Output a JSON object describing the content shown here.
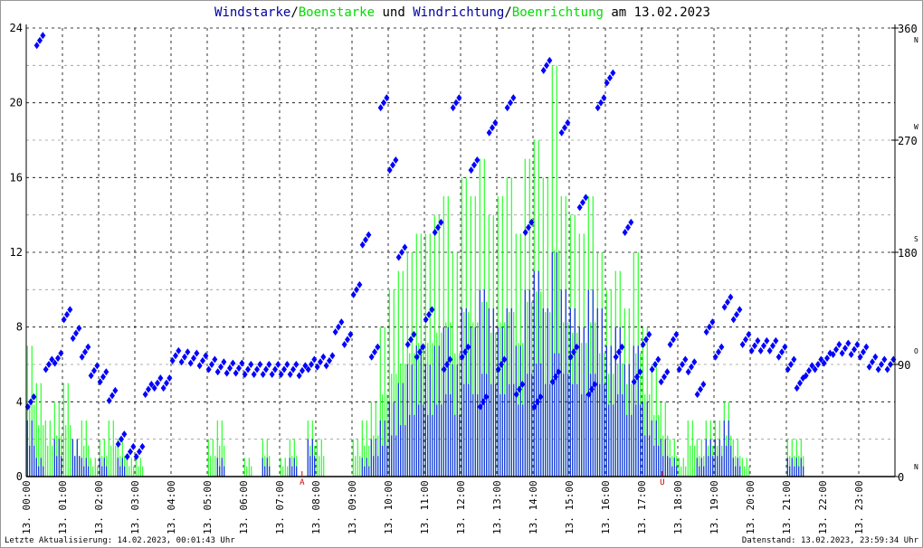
{
  "title": {
    "part1": "Windstarke",
    "sep1": "/",
    "part2": "Boenstarke",
    "mid": " und ",
    "part3": "Windrichtung",
    "sep2": "/",
    "part4": "Boenrichtung",
    "tail": " am 13.02.2023"
  },
  "footer": {
    "left": "Letzte Aktualisierung: 14.02.2023, 00:01:43 Uhr",
    "right": "Datenstand: 13.02.2023, 23:59:34 Uhr"
  },
  "colors": {
    "speed": "#0000ff",
    "gust": "#00ff00",
    "marker": "#cc0000",
    "title_speed": "#0000a0",
    "title_gust": "#00dd00"
  },
  "chart_data": {
    "type": "bar",
    "title": "Windstarke/Boenstarke und Windrichtung/Boenrichtung am 13.02.2023",
    "x_unit": "hour",
    "x_tick_labels": [
      "13. 00:00",
      "13. 01:00",
      "13. 02:00",
      "13. 03:00",
      "13. 04:00",
      "13. 05:00",
      "13. 06:00",
      "13. 07:00",
      "13. 08:00",
      "13. 09:00",
      "13. 10:00",
      "13. 11:00",
      "13. 12:00",
      "13. 13:00",
      "13. 14:00",
      "13. 15:00",
      "13. 16:00",
      "13. 17:00",
      "13. 18:00",
      "13. 19:00",
      "13. 20:00",
      "13. 21:00",
      "13. 22:00",
      "13. 23:00"
    ],
    "xlim": [
      0,
      24
    ],
    "y_left": {
      "ylim": [
        0,
        24
      ],
      "ticks": [
        "0",
        "4",
        "8",
        "12",
        "16",
        "20",
        "24"
      ]
    },
    "y_right": {
      "ylim": [
        0,
        360
      ],
      "ticks": [
        "0",
        "90",
        "180",
        "270",
        "360"
      ],
      "compass": [
        {
          "value": 0,
          "label": "N"
        },
        {
          "value": 90,
          "label": "O"
        },
        {
          "value": 180,
          "label": "S"
        },
        {
          "value": 270,
          "label": "W"
        },
        {
          "value": 360,
          "label": "N"
        }
      ]
    },
    "markers": [
      {
        "hour": 7.62,
        "label": "A"
      },
      {
        "hour": 17.57,
        "label": "U"
      }
    ],
    "grid": true,
    "interval_hours": 0.25,
    "series": [
      {
        "name": "Boenstarke",
        "kind": "bar",
        "values": [
          7,
          5,
          3,
          4,
          5,
          2,
          3,
          1,
          2,
          3,
          2,
          1,
          1,
          0,
          0,
          0,
          0,
          0,
          0,
          0,
          2,
          3,
          0,
          0,
          1,
          0,
          2,
          0,
          1,
          2,
          0,
          3,
          2,
          0,
          0,
          0,
          2,
          3,
          4,
          8,
          10,
          11,
          12,
          13,
          13,
          14,
          15,
          12,
          16,
          15,
          17,
          14,
          15,
          16,
          13,
          17,
          18,
          16,
          22,
          15,
          14,
          13,
          15,
          12,
          10,
          11,
          9,
          12,
          8,
          6,
          4,
          2,
          1,
          3,
          2,
          3,
          3,
          4,
          2,
          1,
          0,
          0,
          0,
          0,
          2,
          2,
          0,
          0,
          0,
          0,
          0,
          0,
          0,
          0,
          0,
          0
        ]
      },
      {
        "name": "Windstarke",
        "kind": "bar",
        "values": [
          3,
          1,
          0,
          2,
          0,
          2,
          1,
          0,
          1,
          0,
          1,
          0,
          0,
          0,
          0,
          0,
          0,
          0,
          0,
          0,
          0,
          1,
          0,
          0,
          0,
          0,
          1,
          0,
          0,
          1,
          0,
          2,
          0,
          0,
          0,
          0,
          0,
          1,
          2,
          3,
          4,
          5,
          6,
          7,
          6,
          7,
          8,
          6,
          9,
          8,
          10,
          9,
          8,
          9,
          7,
          10,
          11,
          9,
          12,
          10,
          9,
          8,
          10,
          9,
          7,
          8,
          6,
          7,
          4,
          3,
          2,
          1,
          0,
          0,
          1,
          2,
          2,
          3,
          1,
          0,
          0,
          0,
          0,
          0,
          1,
          1,
          0,
          0,
          0,
          0,
          0,
          0,
          0,
          0,
          0,
          0
        ]
      },
      {
        "name": "Windrichtung",
        "kind": "scatter",
        "axis": "right",
        "values": [
          60,
          350,
          90,
          95,
          130,
          115,
          100,
          85,
          80,
          65,
          30,
          20,
          20,
          70,
          75,
          75,
          97,
          96,
          95,
          93,
          90,
          88,
          87,
          87,
          86,
          86,
          86,
          86,
          86,
          86,
          85,
          90,
          92,
          93,
          120,
          110,
          150,
          190,
          100,
          300,
          250,
          180,
          110,
          100,
          130,
          200,
          90,
          300,
          100,
          250,
          60,
          280,
          90,
          300,
          70,
          200,
          60,
          330,
          80,
          280,
          100,
          220,
          70,
          300,
          320,
          100,
          200,
          80,
          110,
          90,
          80,
          110,
          90,
          88,
          70,
          120,
          100,
          140,
          130,
          110,
          105,
          105,
          105,
          100,
          90,
          75,
          85,
          90,
          95,
          102,
          103,
          102,
          100,
          92,
          90,
          90
        ]
      }
    ]
  }
}
